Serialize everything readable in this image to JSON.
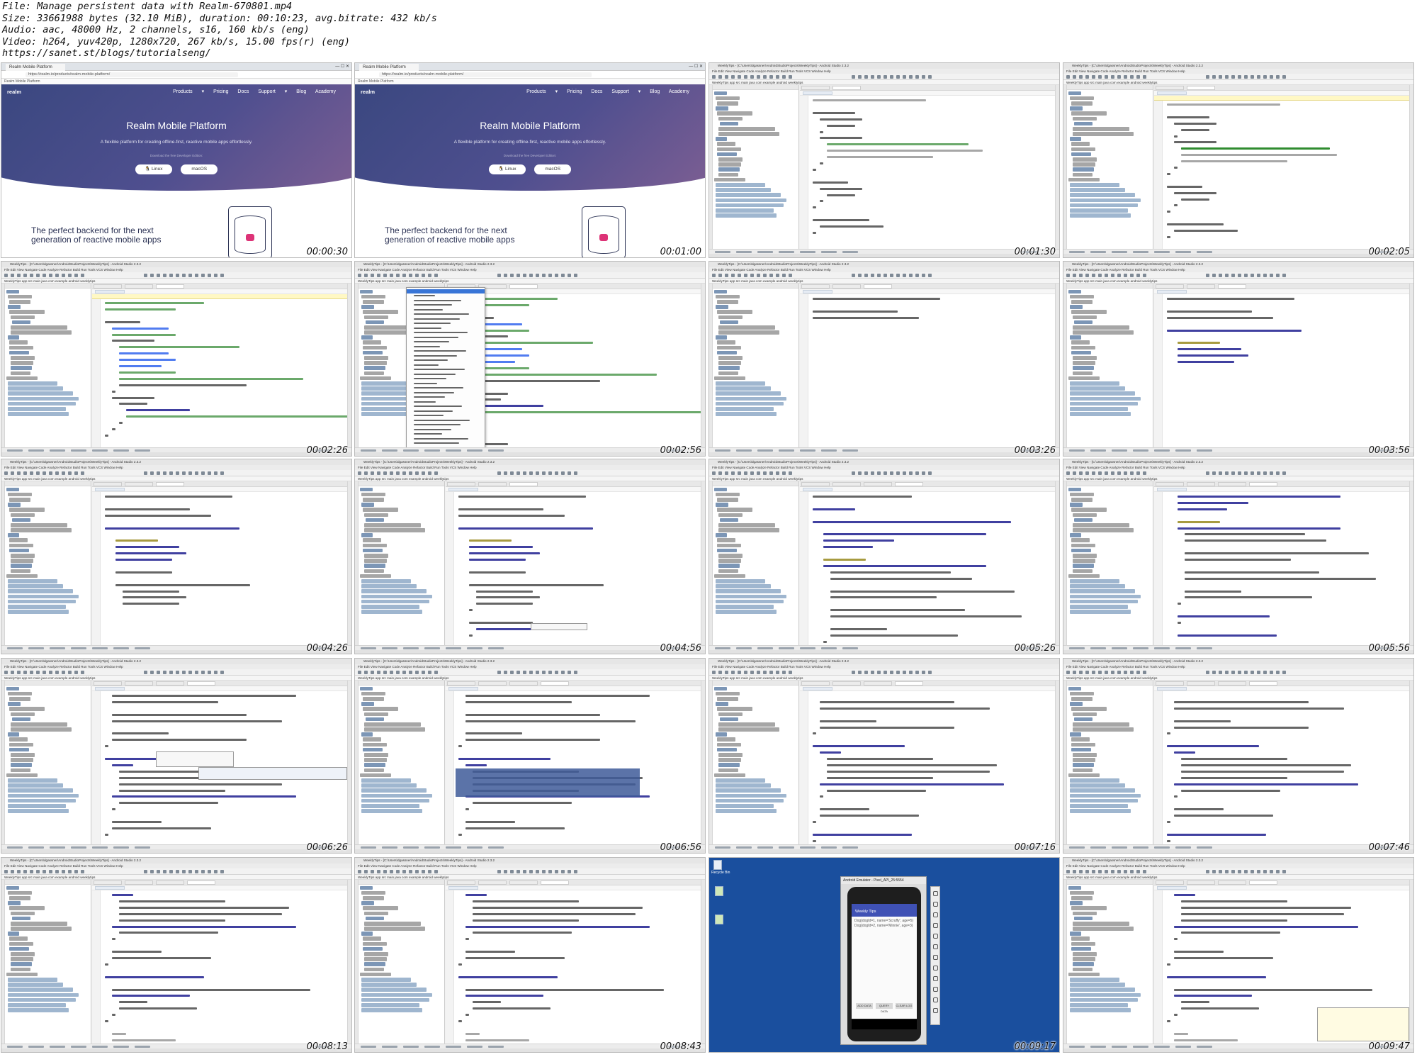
{
  "header": {
    "file": "File: Manage persistent data with Realm-670801.mp4",
    "size": "Size: 33661988 bytes (32.10 MiB), duration: 00:10:23, avg.bitrate: 432 kb/s",
    "audio": "Audio: aac, 48000 Hz, 2 channels, s16, 160 kb/s (eng)",
    "video": "Video: h264, yuv420p, 1280x720, 267 kb/s, 15.00 fps(r) (eng)",
    "url": "https://sanet.st/blogs/tutorialseng/"
  },
  "browser": {
    "tab_title": "Realm Mobile Platform",
    "address": "https://realm.io/products/realm-mobile-platform/",
    "bookmark": "Realm Mobile Platform",
    "logo": "realm",
    "nav": "Products ▾  Pricing  Docs  Support ▾  Blog  Academy",
    "hero_title": "Realm Mobile Platform",
    "hero_subtitle": "A flexible platform for creating offline-first, reactive mobile apps effortlessly.",
    "download_note": "Download the free Developer Edition:",
    "btn_linux": "Linux",
    "btn_macos": "macOS",
    "tagline_1": "The perfect backend for the next",
    "tagline_2": "generation of reactive mobile apps"
  },
  "ide": {
    "title": "WeeklyTips - [C:\\Users\\dgassner\\AndroidStudioProjects\\WeeklyTips] - Android Studio 2.3.2",
    "menu": "File  Edit  View  Navigate  Code  Analyze  Refactor  Build  Run  Tools  VCS  Window  Help",
    "navbar": "WeeklyTips  app  src  main  java  com  example  android  weeklytips"
  },
  "emulator": {
    "window_title": "Android Emulator - Pixel_API_25:5554",
    "app_title": "Weekly Tips",
    "log_line_1": "Dog{dogId=1, name='Scruffy', age=5}",
    "log_line_2": "Dog{dogId=2, name='Minnie', age=3}",
    "btn_1": "ADD DATA",
    "btn_2": "QUERY DATA",
    "btn_3": "CLEAR LOG",
    "recycle_bin": "Recycle Bin"
  },
  "timestamps": [
    "00:00:30",
    "00:01:00",
    "00:01:30",
    "00:02:05",
    "00:02:26",
    "00:02:56",
    "00:03:26",
    "00:03:56",
    "00:04:26",
    "00:04:56",
    "00:05:26",
    "00:05:56",
    "00:06:26",
    "00:06:56",
    "00:07:16",
    "00:07:46",
    "00:08:13",
    "00:08:43",
    "00:09:17",
    "00:09:47"
  ],
  "colors": {
    "hero_start": "#39477f",
    "hero_end": "#7f5f93",
    "accent": "#dd3377",
    "keyword": "#000080",
    "string": "#008000"
  }
}
